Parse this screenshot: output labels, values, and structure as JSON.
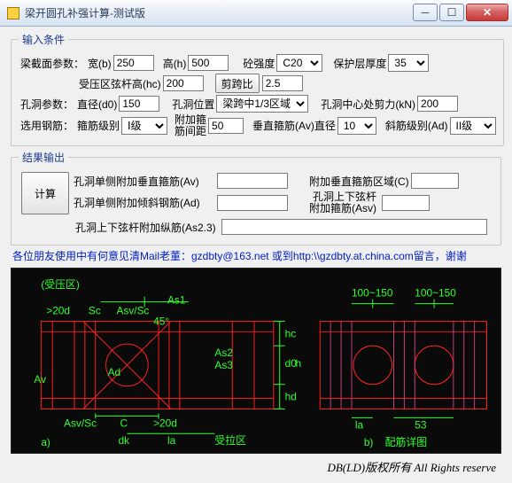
{
  "window": {
    "title": "梁开圆孔补强计算-测试版"
  },
  "groups": {
    "input": "输入条件",
    "output": "结果输出"
  },
  "inputs": {
    "sec_params": "梁截面参数：",
    "width_lbl": "宽(b)",
    "width_val": "250",
    "height_lbl": "高(h)",
    "height_val": "500",
    "conc_lbl": "砼强度",
    "conc_val": "C20",
    "cover_lbl": "保护层厚度",
    "cover_val": "35",
    "hc_lbl": "受压区弦杆高(hc)",
    "hc_val": "200",
    "span_btn": "剪跨比",
    "span_val": "2.5",
    "hole_params": "孔洞参数：",
    "d0_lbl": "直径(d0)",
    "d0_val": "150",
    "pos_lbl": "孔洞位置",
    "pos_val": "梁跨中1/3区域",
    "shear_lbl": "孔洞中心处剪力(kN)",
    "shear_val": "200",
    "rebar_lbl": "选用钢筋：",
    "stirrup_lbl": "箍筋级别",
    "stirrup_val": "Ⅰ级",
    "addstir_l1": "附加箍",
    "addstir_l2": "筋间距",
    "addstir_val": "50",
    "av_lbl": "垂直箍筋(Av)直径",
    "av_val": "10",
    "diag_lbl": "斜筋级别(Ad)",
    "diag_val": "II级"
  },
  "outputs": {
    "calc_btn": "计算",
    "av_lbl": "孔洞单侧附加垂直箍筋(Av)",
    "c_lbl": "附加垂直箍筋区域(C)",
    "ad_lbl": "孔洞单侧附加倾斜钢筋(Ad)",
    "top_l1": "孔洞上下弦杆",
    "top_l2": "附加箍筋(Asv)",
    "as23_lbl": "孔洞上下弦杆附加纵筋(As2.3)"
  },
  "message": "各位朋友使用中有何意见清Mail老董：gzdbty@163.net 或到http:\\\\gzdbty.at.china.com留言，谢谢",
  "copyright": "DB(LD)版权所有 All Rights reserve",
  "diagram": {
    "labels": {
      "zone1": "(受压区)",
      "gt20d_1": ">20d",
      "gt20d_2": ">20d",
      "sc1": "Sc",
      "sc2": "Sc",
      "asvsc1": "Asv/Sc",
      "asvsc2": "Asv/Sc",
      "as1": "As1",
      "as2": "As2",
      "as3": "As3",
      "ang": "45°",
      "av": "Av",
      "ad": "Ad",
      "c": "C",
      "la": "la",
      "dk": "dk",
      "hc": "hc",
      "d0": "d0",
      "hd": "hd",
      "h": "h",
      "zone2": "受拉区",
      "a": "a)",
      "dim1": "100~150",
      "dim2": "100~150",
      "la2": "la",
      "n53": "53",
      "b": "b)",
      "sub": "配筋详图"
    }
  }
}
